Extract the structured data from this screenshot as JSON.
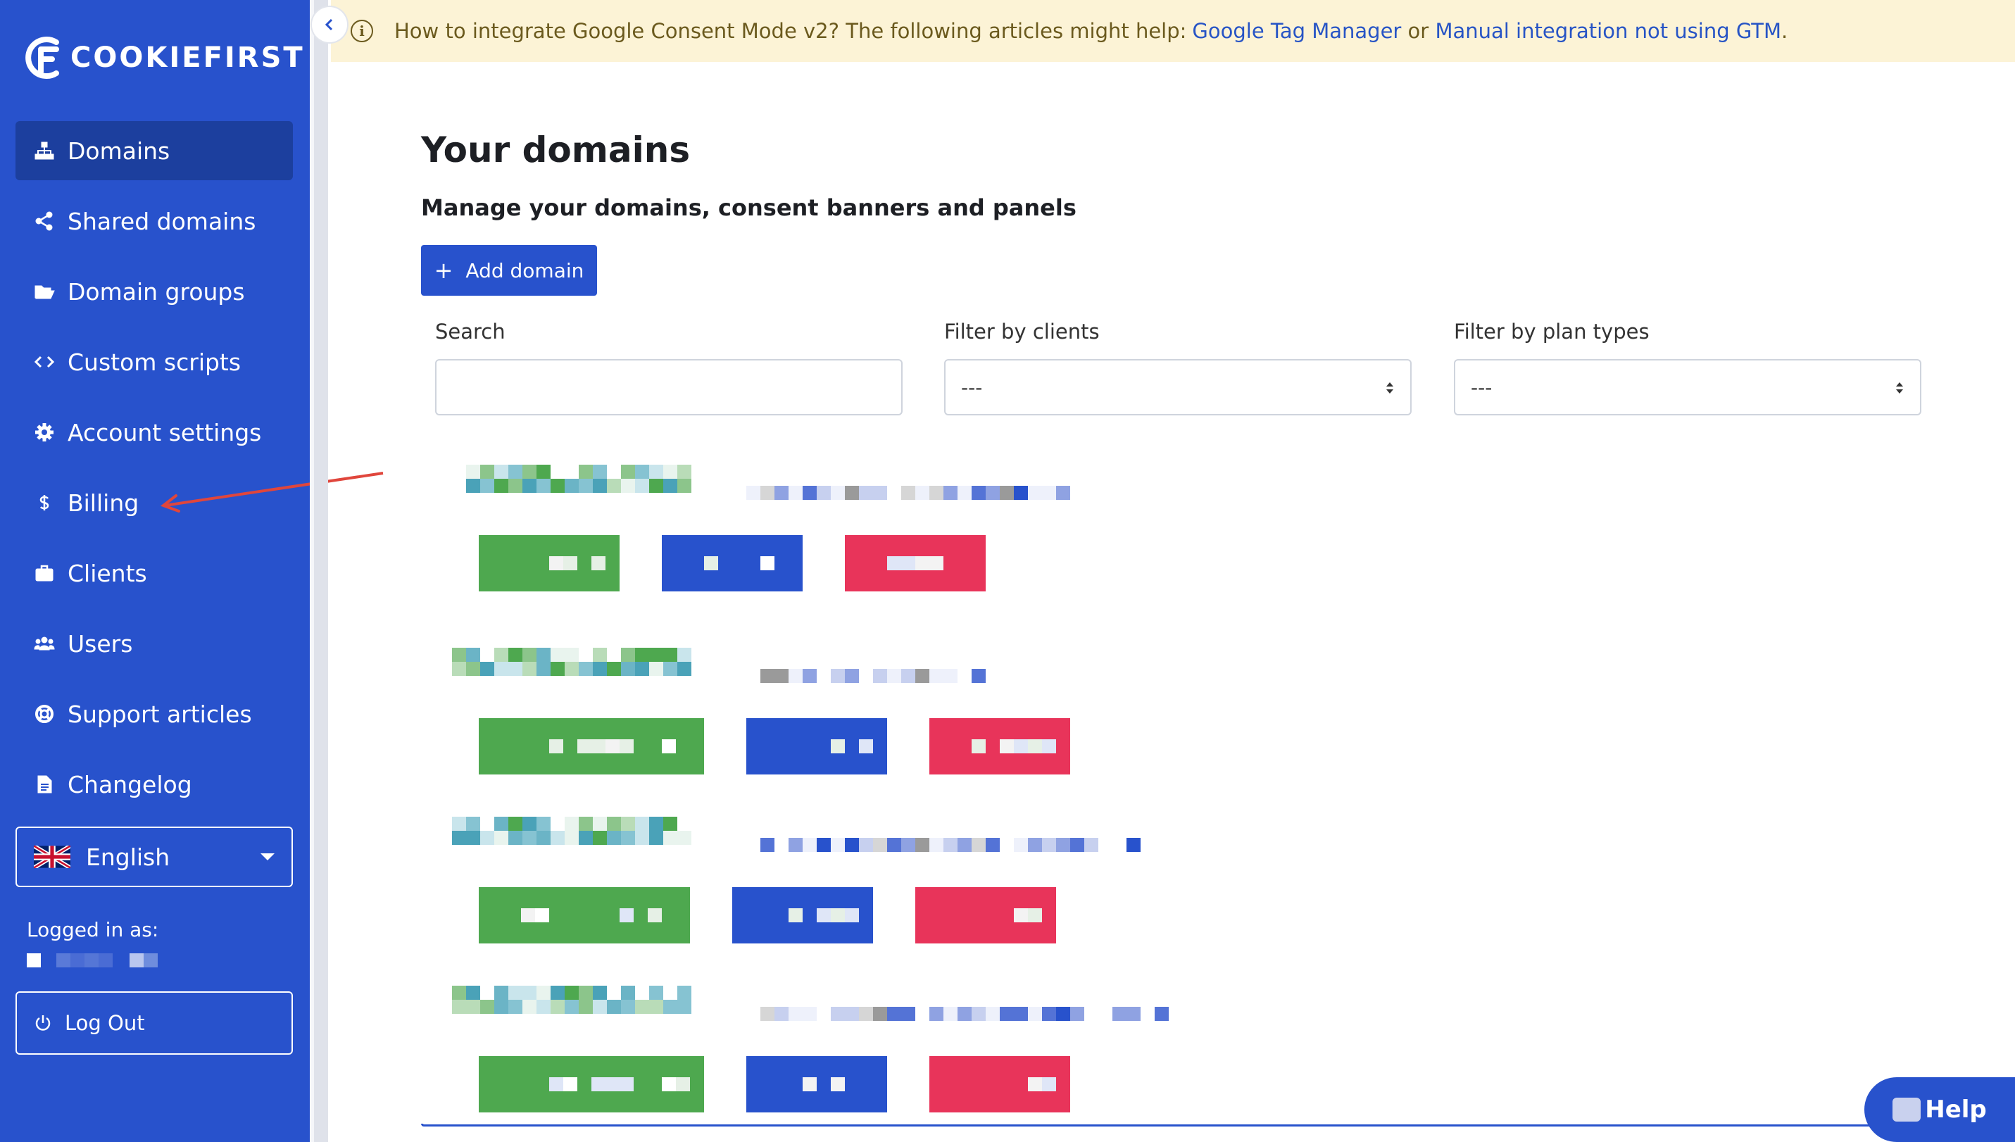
{
  "brand": {
    "name": "COOKIEFIRST",
    "primary": "#2852cc",
    "active": "#1c3f9e"
  },
  "sidebar": {
    "items": [
      {
        "label": "Domains",
        "icon": "sitemap-icon",
        "active": true
      },
      {
        "label": "Shared domains",
        "icon": "share-icon"
      },
      {
        "label": "Domain groups",
        "icon": "folder-open-icon"
      },
      {
        "label": "Custom scripts",
        "icon": "code-icon"
      },
      {
        "label": "Account settings",
        "icon": "gear-icon"
      },
      {
        "label": "Billing",
        "icon": "dollar-icon"
      },
      {
        "label": "Clients",
        "icon": "briefcase-icon"
      },
      {
        "label": "Users",
        "icon": "users-icon"
      },
      {
        "label": "Support articles",
        "icon": "life-ring-icon"
      },
      {
        "label": "Changelog",
        "icon": "file-icon"
      }
    ],
    "language": "English",
    "logged_in_label": "Logged in as:",
    "logout_label": "Log Out"
  },
  "notice": {
    "text": "How to integrate Google Consent Mode v2? The following articles might help: ",
    "link1": "Google Tag Manager",
    "or": " or ",
    "link2": "Manual integration not using GTM",
    "end": "."
  },
  "main": {
    "title": "Your domains",
    "subtitle": "Manage your domains, consent banners and panels",
    "add_button": "Add domain",
    "search_label": "Search",
    "search_value": "",
    "filter_clients_label": "Filter by clients",
    "filter_clients_value": "---",
    "filter_plans_label": "Filter by plan types",
    "filter_plans_value": "---"
  },
  "help_label": "Help",
  "badge_colors": {
    "green": "#4ea84f",
    "blue": "#2852cc",
    "red": "#e8345a"
  }
}
